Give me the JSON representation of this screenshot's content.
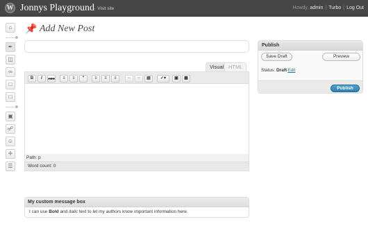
{
  "header": {
    "site_title": "Jonnys Playground",
    "visit_site": "← Visit site",
    "howdy": "Howdy, ",
    "username": "admin",
    "turbo": "Turbo",
    "logout": "Log Out",
    "separator": "|"
  },
  "page": {
    "title": "Add New Post"
  },
  "post": {
    "title_value": ""
  },
  "editor": {
    "tab_visual": "Visual",
    "tab_html": "HTML",
    "path_label": "Path: p",
    "word_count": "Word count: 0",
    "toolbar": {
      "bold": "B",
      "italic": "I",
      "strike": "ABC"
    }
  },
  "publish": {
    "heading": "Publish",
    "save_draft": "Save Draft",
    "preview": "Preview",
    "status_label": "Status:",
    "status_value": "Draft",
    "edit": "Edit",
    "publish_button": "Publish"
  },
  "custom_box": {
    "heading": "My custom message box",
    "text_before": "I can use ",
    "bold_word": "Bold",
    "text_middle": " and ",
    "italic_word": "italic",
    "text_after": " text to let my authors know important information here."
  },
  "menu": {
    "icons": [
      "dashboard-icon",
      "posts-icon",
      "media-icon",
      "links-icon",
      "pages-icon",
      "comments-icon",
      "appearance-icon",
      "plugins-icon",
      "users-icon",
      "tools-icon",
      "settings-icon"
    ]
  },
  "colors": {
    "header_bg": "#464646",
    "link": "#21759b",
    "publish_button": "#2a81b4"
  }
}
